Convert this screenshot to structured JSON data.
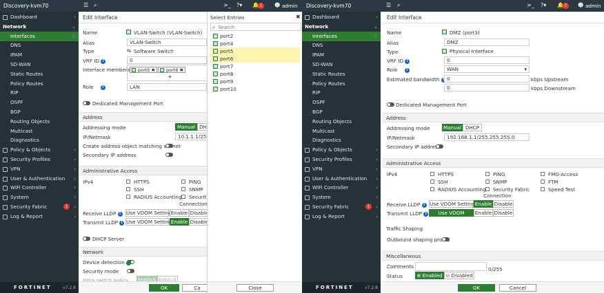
{
  "left": {
    "vm_name": "Discovery-kvm70",
    "notif_count": "1",
    "user": "admin",
    "panel_title": "Edit Interface",
    "name_label": "Name",
    "name_value": "VLAN-Switch (VLAN-Switch)",
    "alias_label": "Alias",
    "alias_value": "VLAN-Switch",
    "type_label": "Type",
    "type_value": "Software Switch",
    "vrf_label": "VRF ID",
    "vrf_value": "0",
    "members_label": "Interface members",
    "members": [
      "port5",
      "port6"
    ],
    "add_symbol": "+",
    "role_label": "Role",
    "role_value": "LAN",
    "dedicated_mgmt": "Dedicated Management Port",
    "address_section": "Address",
    "addr_mode_label": "Addressing mode",
    "addr_mode_manual": "Manual",
    "addr_mode_dhcp": "DHC",
    "ipnet_label": "IP/Netmask",
    "ipnet_value": "10.1.1.1/255.2",
    "create_addr": "Create address object matching subnet",
    "secondary_ip": "Secondary IP address",
    "admin_section": "Administrative Access",
    "ipv4_label": "IPv4",
    "access": [
      "HTTPS",
      "PING",
      "SSH",
      "SNMP",
      "RADIUS Accounting",
      "Security",
      "Connection"
    ],
    "recv_lldp": "Receive LLDP",
    "trans_lldp": "Transmit LLDP",
    "use_vdom": "Use VDOM Setting",
    "enable": "Enable",
    "disable": "Disable",
    "dhcp_server": "DHCP Server",
    "network_section": "Network",
    "device_detect": "Device detection",
    "security_mode": "Security mode",
    "intra_switch": "Intra-switch policy",
    "implicit": "Implicit",
    "explicit": "Explicit",
    "ok": "OK",
    "cancel": "Ca",
    "select_title": "Select Entries",
    "search_placeholder": "Search",
    "entries": [
      "port2",
      "port4",
      "port5",
      "port6",
      "port7",
      "port8",
      "port9",
      "port10"
    ],
    "close": "Close"
  },
  "right": {
    "vm_name": "Discovery-kvm70",
    "notif_count": "1",
    "user": "admin",
    "panel_title": "Edit Interface",
    "name_label": "Name",
    "name_value": "DMZ (port3)",
    "alias_label": "Alias",
    "alias_value": "DMZ",
    "type_label": "Type",
    "type_value": "Physical Interface",
    "vrf_label": "VRF ID",
    "vrf_value": "0",
    "role_label": "Role",
    "role_value": "WAN",
    "est_bw_label": "Estimated bandwidth",
    "bw_up": "0",
    "bw_up_unit": "kbps Upstream",
    "bw_down": "0",
    "bw_down_unit": "kbps Downstream",
    "dedicated_mgmt": "Dedicated Management Port",
    "address_section": "Address",
    "addr_mode_label": "Addressing mode",
    "addr_mode_manual": "Manual",
    "addr_mode_dhcp": "DHCP",
    "ipnet_label": "IP/Netmask",
    "ipnet_value": "192.168.1.1/255.255.255.0",
    "secondary_ip": "Secondary IP address",
    "admin_section": "Administrative Access",
    "ipv4_label": "IPv4",
    "access": [
      "HTTPS",
      "PING",
      "FMG-Access",
      "SSH",
      "SNMP",
      "FTM",
      "RADIUS Accounting",
      "Security Fabric",
      "Speed Test",
      "Connection"
    ],
    "recv_lldp": "Receive LLDP",
    "trans_lldp": "Transmit LLDP",
    "use_vdom": "Use VDOM Setting",
    "enable": "Enable",
    "disable": "Disable",
    "traffic_shaping": "Traffic Shaping",
    "outbound_profile": "Outbound shaping profile",
    "misc_section": "Miscellaneous",
    "comments_label": "Comments",
    "comments_count": "0/255",
    "status_label": "Status",
    "enabled": "Enabled",
    "disabled": "Disabled",
    "ok": "OK",
    "cancel": "Cancel"
  },
  "sidebar": {
    "items": [
      "Dashboard",
      "Network",
      "Interfaces",
      "DNS",
      "IPAM",
      "SD-WAN",
      "Static Routes",
      "Policy Routes",
      "RIP",
      "OSPF",
      "BGP",
      "Routing Objects",
      "Multicast",
      "Diagnostics",
      "Policy & Objects",
      "Security Profiles",
      "VPN",
      "User & Authentication",
      "WiFi Controller",
      "System",
      "Security Fabric",
      "Log & Report"
    ],
    "fabric_badge": "1",
    "logo": "FORTINET",
    "version": "v7.2.8"
  },
  "colors": {
    "accent": "#2e7d32",
    "sidebar": "#263238",
    "topbar": "#2b3a42",
    "selection": "#fdf6b3"
  }
}
